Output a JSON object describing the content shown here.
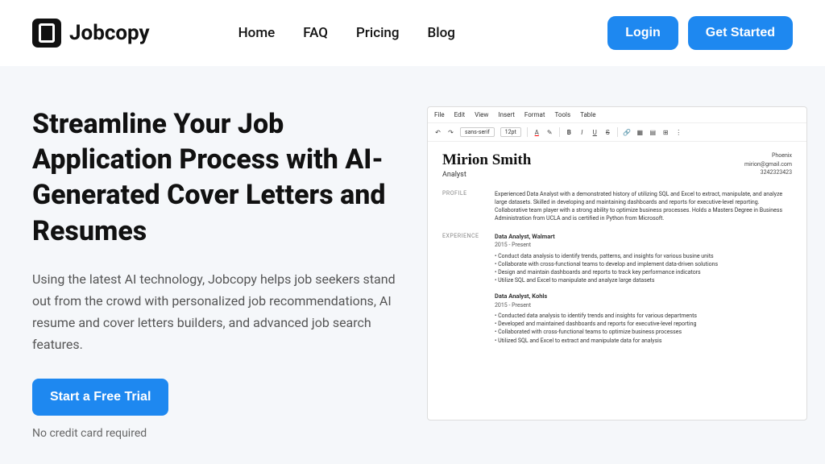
{
  "brand": "Jobcopy",
  "nav": {
    "links": [
      "Home",
      "FAQ",
      "Pricing",
      "Blog"
    ],
    "login": "Login",
    "get_started": "Get Started"
  },
  "hero": {
    "title": "Streamline Your Job Application Process with AI-Generated Cover Letters and Resumes",
    "description": "Using the latest AI technology, Jobcopy helps job seekers stand out from the crowd with personalized job recommendations, AI resume and cover letters builders, and advanced job search features.",
    "cta": "Start a Free Trial",
    "cta_note": "No credit card required"
  },
  "editor": {
    "menus": [
      "File",
      "Edit",
      "View",
      "Insert",
      "Format",
      "Tools",
      "Table"
    ],
    "font": "sans-serif",
    "size": "12pt",
    "resume": {
      "name": "Mirion Smith",
      "role": "Analyst",
      "location": "Phoenix",
      "email": "mirion@gmail.com",
      "phone": "3242323423",
      "profile_label": "PROFILE",
      "profile": "Experienced Data Analyst with a demonstrated history of utilizing SQL and Excel to extract, manipulate, and analyze large datasets. Skilled in developing and maintaining dashboards and reports for executive-level reporting. Collaborative team player with a strong ability to optimize business processes. Holds a Masters Degree in Business Administration from UCLA and is certified in Python from Microsoft.",
      "experience_label": "EXPERIENCE",
      "jobs": [
        {
          "title": "Data Analyst, Walmart",
          "dates": "2015 - Present",
          "bullets": [
            "• Conduct data analysis to identify trends, patterns, and insights for various busine units",
            "• Collaborate with cross-functional teams to develop and implement data-driven solutions",
            "• Design and maintain dashboards and reports to track key performance indicators",
            "• Utilize SQL and Excel to manipulate and analyze large datasets"
          ]
        },
        {
          "title": "Data Analyst, Kohls",
          "dates": "2015 - Present",
          "bullets": [
            "• Conducted data analysis to identify trends and insights for various departments",
            "• Developed and maintained dashboards and reports for executive-level reporting",
            "• Collaborated with cross-functional teams to optimize business processes",
            "• Utilized SQL and Excel to extract and manipulate data for analysis"
          ]
        }
      ]
    }
  }
}
